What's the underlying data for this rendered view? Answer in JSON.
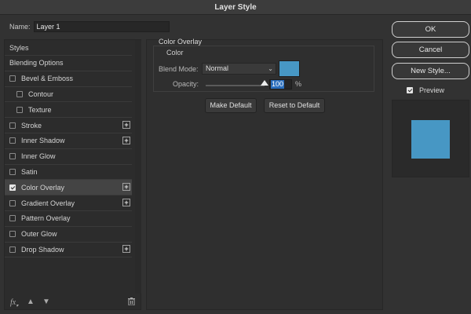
{
  "window": {
    "title": "Layer Style"
  },
  "name_field": {
    "label": "Name:",
    "value": "Layer 1"
  },
  "styles_list": {
    "items": [
      {
        "label": "Styles",
        "kind": "header",
        "checked": false,
        "plus": false,
        "selected": false
      },
      {
        "label": "Blending Options",
        "kind": "header",
        "checked": false,
        "plus": false,
        "selected": false
      },
      {
        "label": "Bevel & Emboss",
        "kind": "item",
        "checked": false,
        "plus": false,
        "selected": false
      },
      {
        "label": "Contour",
        "kind": "sub",
        "checked": false,
        "plus": false,
        "selected": false
      },
      {
        "label": "Texture",
        "kind": "sub",
        "checked": false,
        "plus": false,
        "selected": false
      },
      {
        "label": "Stroke",
        "kind": "item",
        "checked": false,
        "plus": true,
        "selected": false
      },
      {
        "label": "Inner Shadow",
        "kind": "item",
        "checked": false,
        "plus": true,
        "selected": false
      },
      {
        "label": "Inner Glow",
        "kind": "item",
        "checked": false,
        "plus": false,
        "selected": false
      },
      {
        "label": "Satin",
        "kind": "item",
        "checked": false,
        "plus": false,
        "selected": false
      },
      {
        "label": "Color Overlay",
        "kind": "item",
        "checked": true,
        "plus": true,
        "selected": true
      },
      {
        "label": "Gradient Overlay",
        "kind": "item",
        "checked": false,
        "plus": true,
        "selected": false
      },
      {
        "label": "Pattern Overlay",
        "kind": "item",
        "checked": false,
        "plus": false,
        "selected": false
      },
      {
        "label": "Outer Glow",
        "kind": "item",
        "checked": false,
        "plus": false,
        "selected": false
      },
      {
        "label": "Drop Shadow",
        "kind": "item",
        "checked": false,
        "plus": true,
        "selected": false
      }
    ],
    "plus_glyph": "+",
    "footer": {
      "fx_label": "fx",
      "up_icon": "arrow-up-icon",
      "down_icon": "arrow-down-icon",
      "trash_icon": "trash-icon"
    }
  },
  "color_overlay": {
    "section_title": "Color Overlay",
    "group_title": "Color",
    "blend_mode_label": "Blend Mode:",
    "blend_mode_value": "Normal",
    "overlay_color": "#4797c4",
    "opacity_label": "Opacity:",
    "opacity_value": "100",
    "opacity_fraction": 1.0,
    "opacity_unit": "%",
    "make_default_label": "Make Default",
    "reset_default_label": "Reset to Default"
  },
  "actions": {
    "ok_label": "OK",
    "cancel_label": "Cancel",
    "new_style_label": "New Style...",
    "preview_label": "Preview",
    "preview_checked": true
  }
}
